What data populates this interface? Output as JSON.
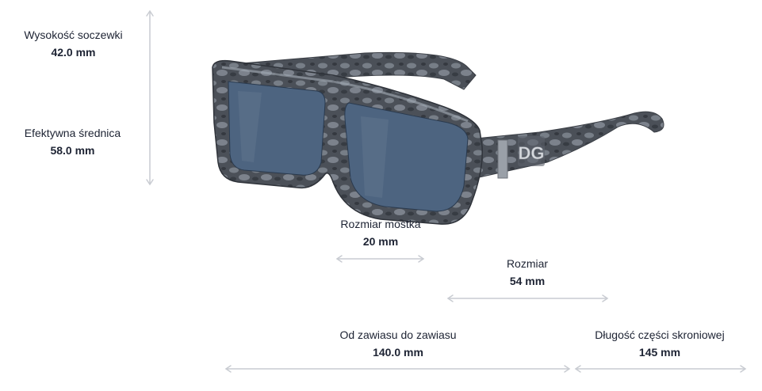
{
  "measurements": {
    "lens_height": {
      "label": "Wysokość soczewki",
      "value": "42.0 mm"
    },
    "effective_diameter": {
      "label": "Efektywna średnica",
      "value": "58.0 mm"
    },
    "bridge_size": {
      "label": "Rozmiar mostka",
      "value": "20 mm"
    },
    "size": {
      "label": "Rozmiar",
      "value": "54 mm"
    },
    "hinge_to_hinge": {
      "label": "Od zawiasu do zawiasu",
      "value": "140.0 mm"
    },
    "temple_length": {
      "label": "Długość części skroniowej",
      "value": "145 mm"
    }
  },
  "product_image": {
    "logo_text": "DG",
    "frame_color": "#4b5058",
    "lens_color": "#4d6480"
  },
  "colors": {
    "arrow": "#c9ccd2",
    "text": "#1d2333"
  }
}
